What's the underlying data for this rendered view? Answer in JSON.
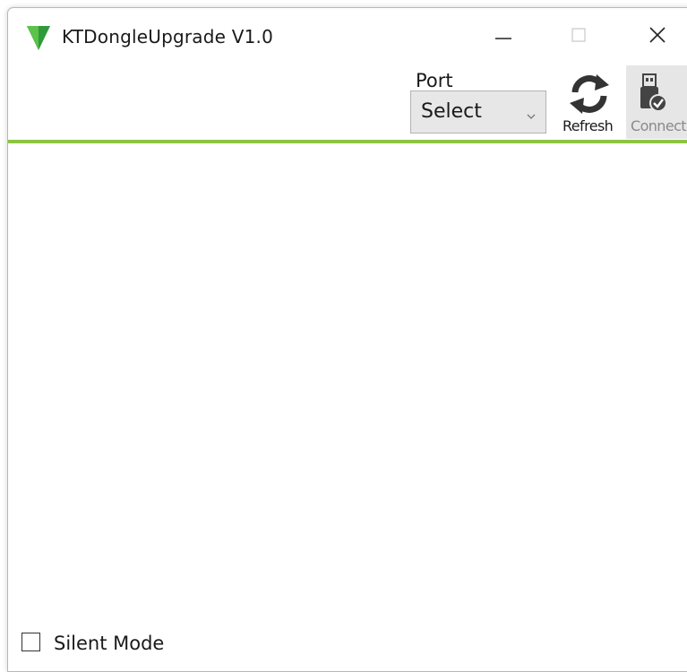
{
  "window": {
    "title": "KTDongleUpgrade V1.0",
    "logo_icon": "green-triangle-logo-icon",
    "controls": {
      "minimize_icon": "minimize-icon",
      "maximize_icon": "maximize-icon",
      "close_icon": "close-icon"
    }
  },
  "toolbar": {
    "port_label": "Port",
    "port_select": {
      "selected": "Select",
      "arrow_icon": "chevron-down-icon"
    },
    "refresh": {
      "label": "Refresh",
      "icon": "refresh-icon"
    },
    "connect": {
      "label": "Connect",
      "icon": "usb-connect-icon",
      "enabled": false
    }
  },
  "footer": {
    "silent_mode_label": "Silent Mode",
    "silent_mode_checked": false
  },
  "colors": {
    "accent": "#8dc443",
    "logo_green": "#4caf3d",
    "disabled_text": "#8a8a8a",
    "button_pressed_bg": "#e6e6e6"
  }
}
